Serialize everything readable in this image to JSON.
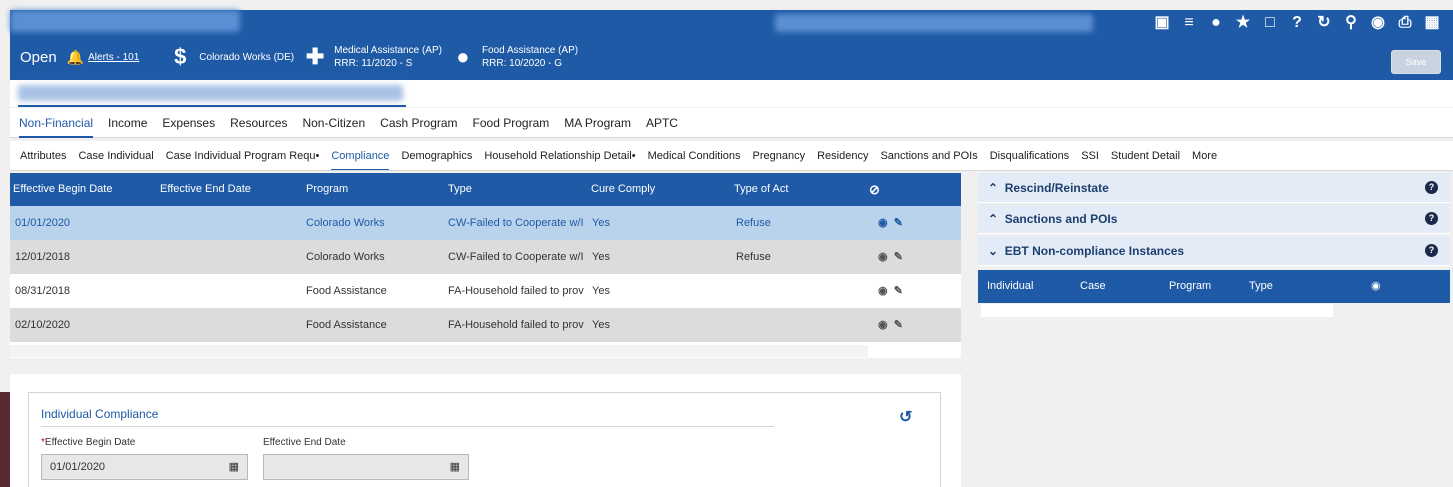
{
  "header": {
    "status": "Open",
    "alerts_link": "Alerts - 101",
    "programs": [
      {
        "icon": "dollar-icon",
        "name": "Colorado Works (DE)",
        "rrr": ""
      },
      {
        "icon": "medical-cross-icon",
        "name": "Medical Assistance (AP)",
        "rrr": "RRR: 11/2020 - S"
      },
      {
        "icon": "apple-icon",
        "name": "Food Assistance (AP)",
        "rrr": "RRR: 10/2020 - G"
      }
    ],
    "save_label": "Save",
    "toolbar_icons": [
      "briefcase-icon",
      "list-icon",
      "coin-icon",
      "star-icon",
      "bookmark-icon",
      "help-icon",
      "refresh-icon",
      "search-icon",
      "chat-icon",
      "print-icon",
      "map-icon"
    ]
  },
  "tabs_primary": [
    "Non-Financial",
    "Income",
    "Expenses",
    "Resources",
    "Non-Citizen",
    "Cash Program",
    "Food Program",
    "MA Program",
    "APTC"
  ],
  "tabs_primary_active": "Non-Financial",
  "tabs_secondary": [
    "Attributes",
    "Case Individual",
    "Case Individual Program Requ•",
    "Compliance",
    "Demographics",
    "Household Relationship Detail•",
    "Medical Conditions",
    "Pregnancy",
    "Residency",
    "Sanctions and POIs",
    "Disqualifications",
    "SSI",
    "Student Detail",
    "More"
  ],
  "tabs_secondary_active": "Compliance",
  "table": {
    "columns": [
      "Effective Begin Date",
      "Effective End Date",
      "Program",
      "Type",
      "Cure Comply",
      "Type of Act",
      "⊘"
    ],
    "rows": [
      {
        "begin": "01/01/2020",
        "end": "",
        "program": "Colorado Works",
        "type": "CW-Failed to Cooperate w/I",
        "cure": "Yes",
        "act": "Refuse"
      },
      {
        "begin": "12/01/2018",
        "end": "",
        "program": "Colorado Works",
        "type": "CW-Failed to Cooperate w/I",
        "cure": "Yes",
        "act": "Refuse"
      },
      {
        "begin": "08/31/2018",
        "end": "",
        "program": "Food Assistance",
        "type": "FA-Household failed to prov",
        "cure": "Yes",
        "act": ""
      },
      {
        "begin": "02/10/2020",
        "end": "",
        "program": "Food Assistance",
        "type": "FA-Household failed to prov",
        "cure": "Yes",
        "act": ""
      }
    ]
  },
  "right_panel": {
    "sections": [
      {
        "label": "Rescind/Reinstate",
        "expanded": false
      },
      {
        "label": "Sanctions and POIs",
        "expanded": false
      },
      {
        "label": "EBT Non-compliance Instances",
        "expanded": true
      }
    ],
    "columns": [
      "Individual",
      "Case",
      "Program",
      "Type"
    ]
  },
  "form": {
    "title": "Individual Compliance",
    "begin_label": "Effective Begin Date",
    "begin_required": "*",
    "begin_value": "01/01/2020",
    "end_label": "Effective End Date",
    "end_value": ""
  }
}
